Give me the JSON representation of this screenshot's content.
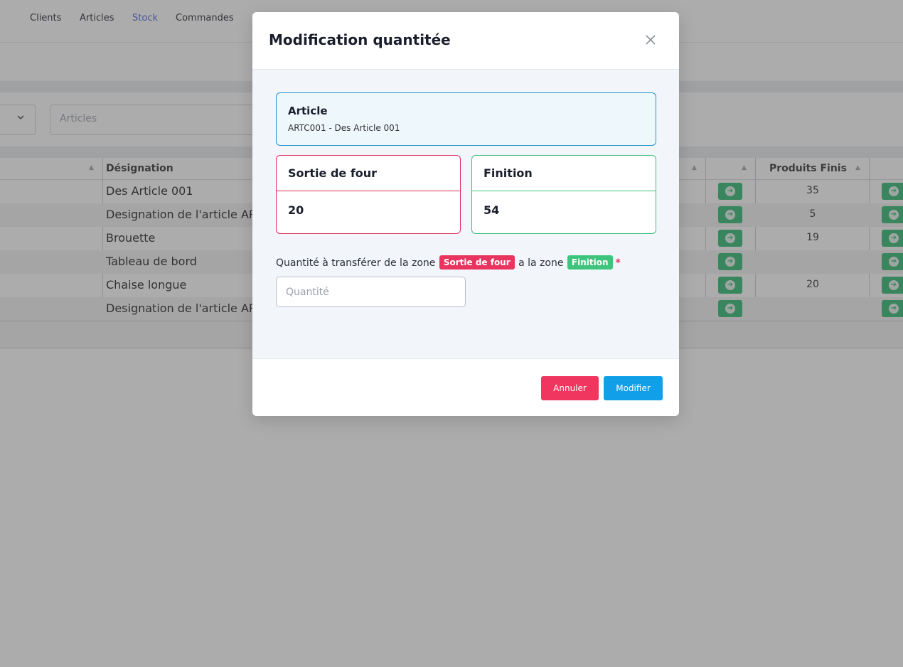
{
  "nav": {
    "items": [
      "Clients",
      "Articles",
      "Stock",
      "Commandes"
    ],
    "active": "Stock"
  },
  "filters": {
    "search_placeholder": "Articles"
  },
  "table": {
    "headers": {
      "designation": "Désignation",
      "produits_finis": "Produits Finis"
    },
    "rows": [
      {
        "designation": "Des Article 001",
        "produits_finis": "35"
      },
      {
        "designation": "Designation de l'article AR",
        "produits_finis": "5"
      },
      {
        "designation": "Brouette",
        "produits_finis": "19"
      },
      {
        "designation": "Tableau de bord",
        "produits_finis": ""
      },
      {
        "designation": "Chaise longue",
        "produits_finis": "20"
      },
      {
        "designation": "Designation de l'article AR",
        "produits_finis": ""
      }
    ]
  },
  "modal": {
    "title": "Modification quantitée",
    "article": {
      "label": "Article",
      "value": "ARTC001 - Des Article 001"
    },
    "zone_from": {
      "name": "Sortie de four",
      "quantity": "20"
    },
    "zone_to": {
      "name": "Finition",
      "quantity": "54"
    },
    "transfer": {
      "text_before": "Quantité à transférer de la zone",
      "text_middle": "a la zone",
      "badge_from": "Sortie de four",
      "badge_to": "Finition",
      "required_mark": "*"
    },
    "quantity_input": {
      "value": "",
      "placeholder": "Quantité"
    },
    "buttons": {
      "cancel": "Annuler",
      "submit": "Modifier"
    }
  },
  "colors": {
    "danger": "#f0365f",
    "success": "#3ec47d",
    "primary": "#119fe9",
    "info_border": "#1e95c9"
  }
}
